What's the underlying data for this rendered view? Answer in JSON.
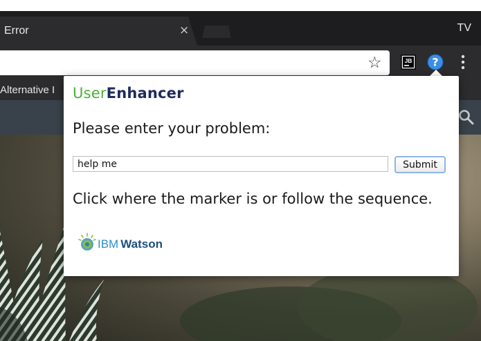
{
  "browser": {
    "tab": {
      "title": "Error",
      "close_glyph": "×"
    },
    "profile_label": "TV",
    "toolbar": {
      "bookmark_star_icon": "star-outline-icon",
      "extensions": [
        {
          "name": "jetbrains-extension-icon",
          "text": "JB"
        },
        {
          "name": "help-question-icon",
          "text": "?",
          "color": "#3a8ee6"
        }
      ],
      "menu_icon": "vertical-dots-icon"
    },
    "bookmarks": {
      "visible_label": "Alternative I"
    }
  },
  "site": {
    "search_icon": "magnifier-icon"
  },
  "popup": {
    "brand_part1": "User",
    "brand_part2": "Enhancer",
    "prompt": "Please enter your problem:",
    "input_value": "help me",
    "submit_label": "Submit",
    "instruction": "Click where the marker is or follow the sequence.",
    "logo": {
      "ibm": "IBM",
      "watson": "Watson"
    }
  },
  "colors": {
    "brand_green": "#4caf38",
    "brand_navy": "#1f2a5c",
    "help_blue": "#3a8ee6",
    "chrome_dark": "#2c2c2e",
    "site_header": "#39424a"
  }
}
